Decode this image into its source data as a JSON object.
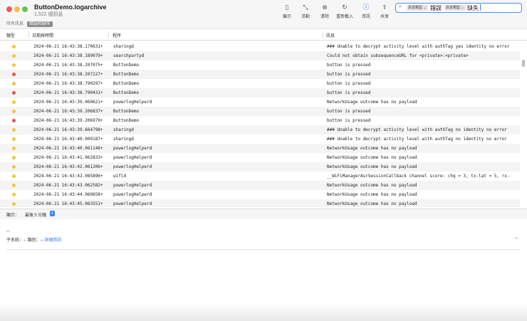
{
  "window": {
    "title": "ButtonDemo.logarchive",
    "subtitle": "1,522 個訊息"
  },
  "toolbar": {
    "tools": [
      {
        "label": "顯示",
        "icon": "sidebar-icon"
      },
      {
        "label": "活動",
        "icon": "activity-icon"
      },
      {
        "label": "清除",
        "icon": "clear-icon"
      },
      {
        "label": "重新載入",
        "icon": "reload-icon"
      },
      {
        "label": "資訊",
        "icon": "info-icon"
      },
      {
        "label": "共享",
        "icon": "share-icon"
      }
    ]
  },
  "search": {
    "token1": "訊息類型 ⌄",
    "value1": "錯誤",
    "token2": "訊息類型 ⌄",
    "value2": "缺失"
  },
  "scope": {
    "all": "所有訊息",
    "errors": "錯誤和缺失"
  },
  "columns": {
    "type": "類型",
    "datetime": "日期與時間",
    "process": "程序",
    "message": "訊息"
  },
  "colors": {
    "yellow": "#f5c33b",
    "red": "#e6534e",
    "accent": "#2f7bf5"
  },
  "rows": [
    {
      "level": "yellow",
      "date": "2024-06-21 16:43:38.170631+",
      "process": "sharingd",
      "message": "### Unable to decrypt activity level with authTag yes identity no error"
    },
    {
      "level": "yellow",
      "date": "2024-06-21 16:43:38.189079+",
      "process": "searchpartyd",
      "message": "Could not obtain subsequenceURL for <private>:<private>"
    },
    {
      "level": "yellow",
      "date": "2024-06-21 16:43:38.207075+",
      "process": "ButtonDemo",
      "message": "button is pressed"
    },
    {
      "level": "red",
      "date": "2024-06-21 16:43:38.207227+",
      "process": "ButtonDemo",
      "message": "button is pressed"
    },
    {
      "level": "yellow",
      "date": "2024-06-21 16:43:38.790297+",
      "process": "ButtonDemo",
      "message": "button is pressed"
    },
    {
      "level": "red",
      "date": "2024-06-21 16:43:38.790431+",
      "process": "ButtonDemo",
      "message": "button is pressed"
    },
    {
      "level": "yellow",
      "date": "2024-06-21 16:43:39.060621+",
      "process": "powerlogHelperd",
      "message": "NetworkUsage outcome has no payload"
    },
    {
      "level": "yellow",
      "date": "2024-06-21 16:43:39.206837+",
      "process": "ButtonDemo",
      "message": "button is pressed"
    },
    {
      "level": "red",
      "date": "2024-06-21 16:43:39.206979+",
      "process": "ButtonDemo",
      "message": "button is pressed"
    },
    {
      "level": "yellow",
      "date": "2024-06-21 16:43:39.664798+",
      "process": "sharingd",
      "message": "### Unable to decrypt activity level with authTag no identity no error"
    },
    {
      "level": "yellow",
      "date": "2024-06-21 16:43:40.009187+",
      "process": "sharingd",
      "message": "### Unable to decrypt activity level with authTag no identity no error"
    },
    {
      "level": "yellow",
      "date": "2024-06-21 16:43:40.061146+",
      "process": "powerlogHelperd",
      "message": "NetworkUsage outcome has no payload"
    },
    {
      "level": "yellow",
      "date": "2024-06-21 16:43:41.062833+",
      "process": "powerlogHelperd",
      "message": "NetworkUsage outcome has no payload"
    },
    {
      "level": "yellow",
      "date": "2024-06-21 16:43:42.061206+",
      "process": "powerlogHelperd",
      "message": "NetworkUsage outcome has no payload"
    },
    {
      "level": "yellow",
      "date": "2024-06-21 16:43:42.085896+",
      "process": "wifid",
      "message": "__WiFiManagerAsrSessionCallback channel score: chq = 3, tx-lat = 5, rx-"
    },
    {
      "level": "yellow",
      "date": "2024-06-21 16:43:43.062582+",
      "process": "powerlogHelperd",
      "message": "NetworkUsage outcome has no payload"
    },
    {
      "level": "yellow",
      "date": "2024-06-21 16:43:44.060658+",
      "process": "powerlogHelperd",
      "message": "NetworkUsage outcome has no payload"
    },
    {
      "level": "yellow",
      "date": "2024-06-21 16:43:45.063551+",
      "process": "powerlogHelperd",
      "message": "NetworkUsage outcome has no payload"
    }
  ],
  "status": {
    "label": "顯示：",
    "value": "最後５分鐘"
  },
  "detail": {
    "main": "--",
    "subsystem": "子系統：-- 類別：--",
    "link": "詳細資訊",
    "right": "--"
  }
}
